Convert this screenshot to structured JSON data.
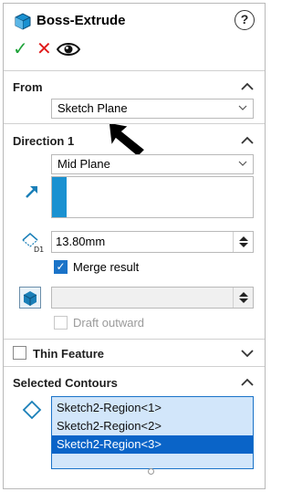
{
  "title": "Boss-Extrude",
  "help_label": "?",
  "actions": {
    "ok": "✓",
    "cancel": "✕"
  },
  "from": {
    "header": "From",
    "start_condition": "Sketch Plane"
  },
  "direction1": {
    "header": "Direction 1",
    "end_condition": "Mid Plane",
    "depth_value": "13.80mm",
    "merge_result_label": "Merge result",
    "merge_result_checked": true,
    "draft_outward_label": "Draft outward",
    "draft_outward_checked": false
  },
  "thin_feature": {
    "label": "Thin Feature",
    "checked": false
  },
  "selected_contours": {
    "header": "Selected Contours",
    "items": [
      "Sketch2-Region<1>",
      "Sketch2-Region<2>",
      "Sketch2-Region<3>"
    ],
    "selected_index": 2
  },
  "colors": {
    "accent_blue": "#1a91d1",
    "selection_blue": "#0a64c8",
    "ok_green": "#1fa33a",
    "cancel_red": "#e01b1b"
  }
}
